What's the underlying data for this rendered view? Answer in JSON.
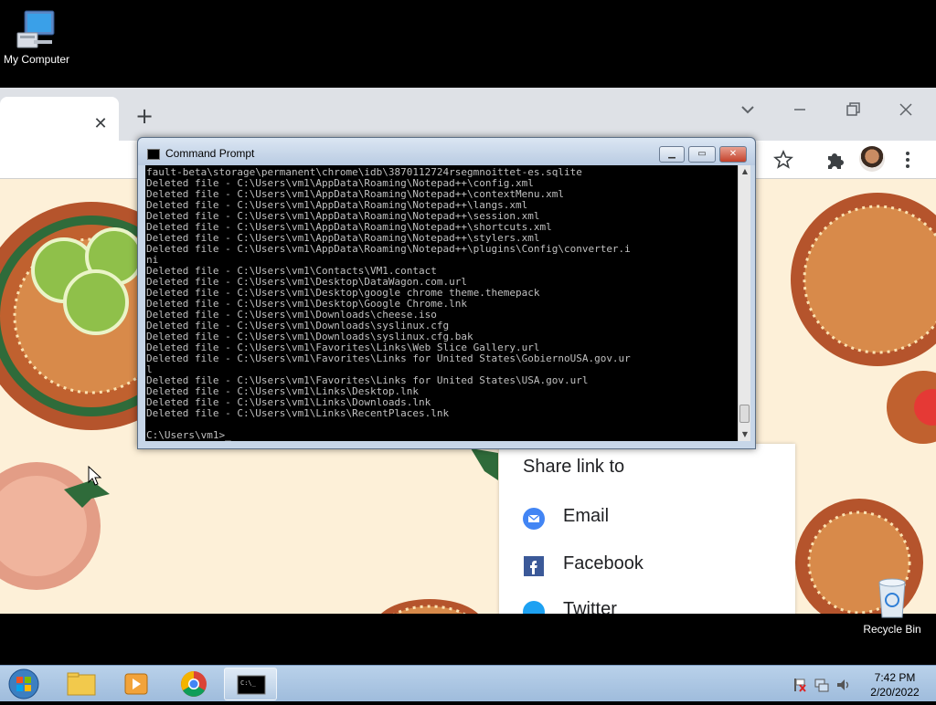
{
  "desktop": {
    "my_computer_label": "My Computer",
    "recycle_bin_label": "Recycle Bin"
  },
  "chrome": {
    "tab_close": "✕",
    "new_tab": "+",
    "share": {
      "title": "Share link to",
      "items": [
        {
          "label": "Email",
          "icon": "email-icon"
        },
        {
          "label": "Facebook",
          "icon": "facebook-icon"
        },
        {
          "label": "Twitter",
          "icon": "twitter-icon"
        }
      ]
    }
  },
  "cmd": {
    "title": "Command Prompt",
    "lines": [
      "fault-beta\\storage\\permanent\\chrome\\idb\\3870112724rsegmnoittet-es.sqlite",
      "Deleted file - C:\\Users\\vm1\\AppData\\Roaming\\Notepad++\\config.xml",
      "Deleted file - C:\\Users\\vm1\\AppData\\Roaming\\Notepad++\\contextMenu.xml",
      "Deleted file - C:\\Users\\vm1\\AppData\\Roaming\\Notepad++\\langs.xml",
      "Deleted file - C:\\Users\\vm1\\AppData\\Roaming\\Notepad++\\session.xml",
      "Deleted file - C:\\Users\\vm1\\AppData\\Roaming\\Notepad++\\shortcuts.xml",
      "Deleted file - C:\\Users\\vm1\\AppData\\Roaming\\Notepad++\\stylers.xml",
      "Deleted file - C:\\Users\\vm1\\AppData\\Roaming\\Notepad++\\plugins\\Config\\converter.i",
      "ni",
      "Deleted file - C:\\Users\\vm1\\Contacts\\VM1.contact",
      "Deleted file - C:\\Users\\vm1\\Desktop\\DataWagon.com.url",
      "Deleted file - C:\\Users\\vm1\\Desktop\\google chrome theme.themepack",
      "Deleted file - C:\\Users\\vm1\\Desktop\\Google Chrome.lnk",
      "Deleted file - C:\\Users\\vm1\\Downloads\\cheese.iso",
      "Deleted file - C:\\Users\\vm1\\Downloads\\syslinux.cfg",
      "Deleted file - C:\\Users\\vm1\\Downloads\\syslinux.cfg.bak",
      "Deleted file - C:\\Users\\vm1\\Favorites\\Links\\Web Slice Gallery.url",
      "Deleted file - C:\\Users\\vm1\\Favorites\\Links for United States\\GobiernoUSA.gov.ur",
      "l",
      "Deleted file - C:\\Users\\vm1\\Favorites\\Links for United States\\USA.gov.url",
      "Deleted file - C:\\Users\\vm1\\Links\\Desktop.lnk",
      "Deleted file - C:\\Users\\vm1\\Links\\Downloads.lnk",
      "Deleted file - C:\\Users\\vm1\\Links\\RecentPlaces.lnk",
      "",
      "C:\\Users\\vm1>_"
    ]
  },
  "taskbar": {
    "time": "7:42 PM",
    "date": "2/20/2022"
  }
}
